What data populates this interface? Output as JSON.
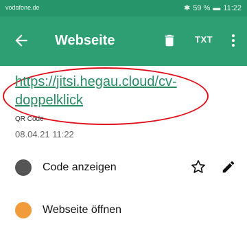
{
  "status_bar": {
    "carrier": "vodafone.de",
    "battery": "59 %",
    "time": "11:22"
  },
  "app_bar": {
    "title": "Webseite",
    "txt_label": "TXT"
  },
  "content": {
    "url": "https://jitsi.hegau.cloud/cv-doppelklick",
    "type_label": "QR Code",
    "timestamp": "08.04.21 11:22"
  },
  "actions": {
    "show_code": "Code anzeigen",
    "open_website": "Webseite öffnen"
  },
  "colors": {
    "primary": "#2e9e73",
    "status_bar": "#27956a",
    "link": "#2a8a64",
    "highlight_oval": "#e0101a",
    "web_icon": "#f29b3a"
  },
  "icons": [
    "back-icon",
    "trash-icon",
    "txt-icon",
    "more-icon",
    "code-icon",
    "star-icon",
    "pen-icon",
    "web-icon"
  ]
}
